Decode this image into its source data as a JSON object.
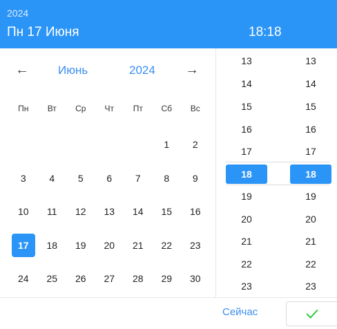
{
  "header": {
    "year": "2024",
    "date": "Пн 17 Июня",
    "time": "18:18"
  },
  "nav": {
    "prev_icon": "arrow-left-icon",
    "prev_glyph": "←",
    "month": "Июнь",
    "year": "2024",
    "next_icon": "arrow-right-icon",
    "next_glyph": "→"
  },
  "weekdays": [
    "Пн",
    "Вт",
    "Ср",
    "Чт",
    "Пт",
    "Сб",
    "Вс"
  ],
  "days": [
    "",
    "",
    "",
    "",
    "",
    "1",
    "2",
    "3",
    "4",
    "5",
    "6",
    "7",
    "8",
    "9",
    "10",
    "11",
    "12",
    "13",
    "14",
    "15",
    "16",
    "17",
    "18",
    "19",
    "20",
    "21",
    "22",
    "23",
    "24",
    "25",
    "26",
    "27",
    "28",
    "29",
    "30"
  ],
  "selected_day": "17",
  "hours": [
    "13",
    "14",
    "15",
    "16",
    "17",
    "18",
    "19",
    "20",
    "21",
    "22",
    "23"
  ],
  "minutes": [
    "13",
    "14",
    "15",
    "16",
    "17",
    "18",
    "19",
    "20",
    "21",
    "22",
    "23"
  ],
  "selected_hour": "18",
  "selected_minute": "18",
  "footer": {
    "now_label": "Сейчас",
    "ok_icon": "checkmark-icon"
  },
  "colors": {
    "accent": "#2b95f7",
    "link": "#3a8ef0",
    "check": "#2ecc40"
  }
}
